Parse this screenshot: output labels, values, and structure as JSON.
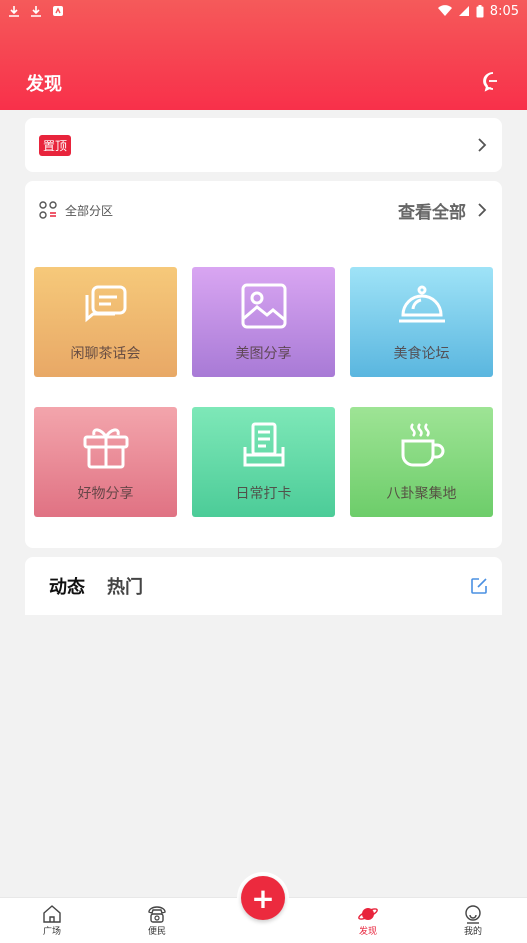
{
  "status_bar": {
    "time": "8:05"
  },
  "header": {
    "title": "发现"
  },
  "pinned": {
    "badge": "置顶"
  },
  "categories": {
    "title": "全部分区",
    "view_all": "查看全部",
    "tiles": [
      {
        "label": "闲聊茶话会",
        "icon": "chat-bubbles-icon"
      },
      {
        "label": "美图分享",
        "icon": "image-icon"
      },
      {
        "label": "美食论坛",
        "icon": "cloche-icon"
      },
      {
        "label": "好物分享",
        "icon": "gift-icon"
      },
      {
        "label": "日常打卡",
        "icon": "check-in-icon"
      },
      {
        "label": "八卦聚集地",
        "icon": "coffee-cup-icon"
      }
    ]
  },
  "feed_tabs": {
    "tab1": "动态",
    "tab2": "热门"
  },
  "bottom_nav": {
    "items": [
      {
        "label": "广场",
        "icon": "home-icon"
      },
      {
        "label": "便民",
        "icon": "telephone-icon"
      },
      {
        "label": "发现",
        "icon": "planet-icon"
      },
      {
        "label": "我的",
        "icon": "user-face-icon"
      }
    ],
    "fab": "+"
  },
  "colors": {
    "accent": "#e8243c",
    "header_top": "#f55a5a",
    "header_bottom": "#f8304a"
  }
}
